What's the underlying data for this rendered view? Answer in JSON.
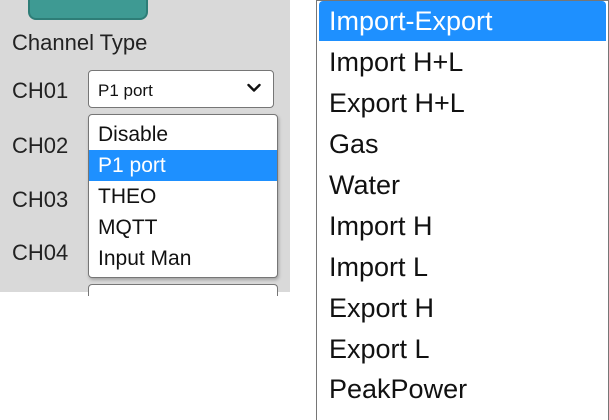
{
  "channel_panel": {
    "section_title": "Channel Type",
    "channels": [
      {
        "label": "CH01",
        "selected_value": "P1 port"
      },
      {
        "label": "CH02"
      },
      {
        "label": "CH03"
      },
      {
        "label": "CH04"
      }
    ]
  },
  "channel_type_dropdown": {
    "options": [
      "Disable",
      "P1 port",
      "THEO",
      "MQTT",
      "Input Man"
    ],
    "selected": "P1 port"
  },
  "meter_type_dropdown": {
    "options": [
      "Import-Export",
      "Import H+L",
      "Export H+L",
      "Gas",
      "Water",
      "Import H",
      "Import L",
      "Export H",
      "Export L",
      "PeakPower"
    ],
    "selected": "Import-Export"
  },
  "colors": {
    "panel_background": "#d9d9d9",
    "selection_highlight": "#1e90ff",
    "top_button": "#3e9a93"
  },
  "icons": {
    "select_arrow": "chevron-down-icon"
  }
}
